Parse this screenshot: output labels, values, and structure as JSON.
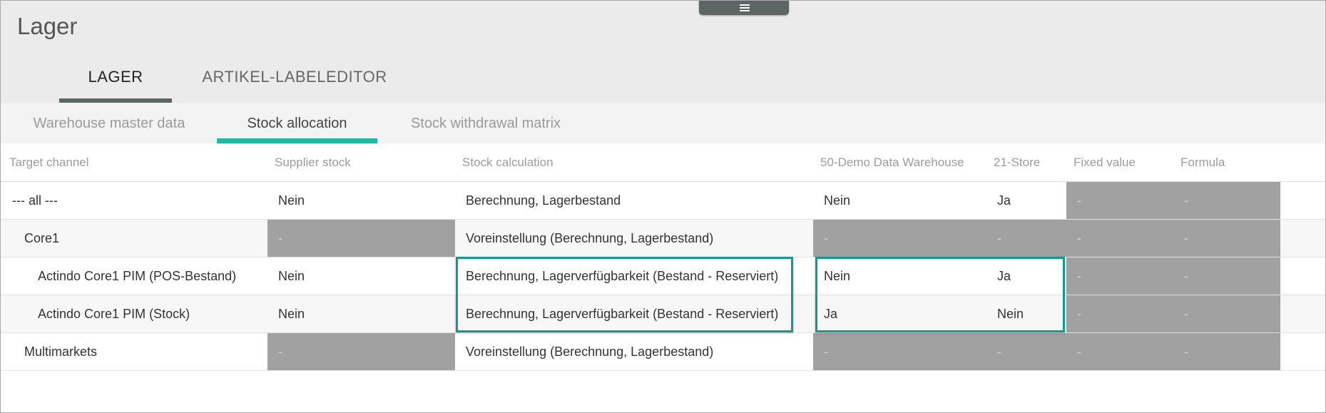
{
  "page": {
    "title": "Lager"
  },
  "menu_handle": {
    "icon": "hamburger-menu-icon"
  },
  "main_tabs": [
    {
      "label": "LAGER",
      "active": true
    },
    {
      "label": "ARTIKEL-LABELEDITOR",
      "active": false
    }
  ],
  "sub_tabs": [
    {
      "label": "Warehouse master data",
      "active": false
    },
    {
      "label": "Stock allocation",
      "active": true
    },
    {
      "label": "Stock withdrawal matrix",
      "active": false
    }
  ],
  "colors": {
    "accent": "#1fb8a0",
    "highlight_border": "#139a8d",
    "disabled_cell": "#a1a1a1"
  },
  "table": {
    "columns": [
      "Target channel",
      "Supplier stock",
      "Stock calculation",
      "50-Demo Data Warehouse",
      "21-Store",
      "Fixed value",
      "Formula"
    ],
    "rows": [
      [
        "--- all ---",
        "Nein",
        "Berechnung, Lagerbestand",
        "Nein",
        "Ja",
        "-",
        "-"
      ],
      [
        "Core1",
        "-",
        "Voreinstellung (Berechnung, Lagerbestand)",
        "-",
        "-",
        "-",
        "-"
      ],
      [
        "Actindo Core1 PIM (POS-Bestand)",
        "Nein",
        "Berechnung, Lagerverfügbarkeit (Bestand - Reserviert)",
        "Nein",
        "Ja",
        "-",
        "-"
      ],
      [
        "Actindo Core1 PIM (Stock)",
        "Nein",
        "Berechnung, Lagerverfügbarkeit (Bestand - Reserviert)",
        "Ja",
        "Nein",
        "-",
        "-"
      ],
      [
        "Multimarkets",
        "-",
        "Voreinstellung (Berechnung, Lagerbestand)",
        "-",
        "-",
        "-",
        "-"
      ]
    ]
  }
}
